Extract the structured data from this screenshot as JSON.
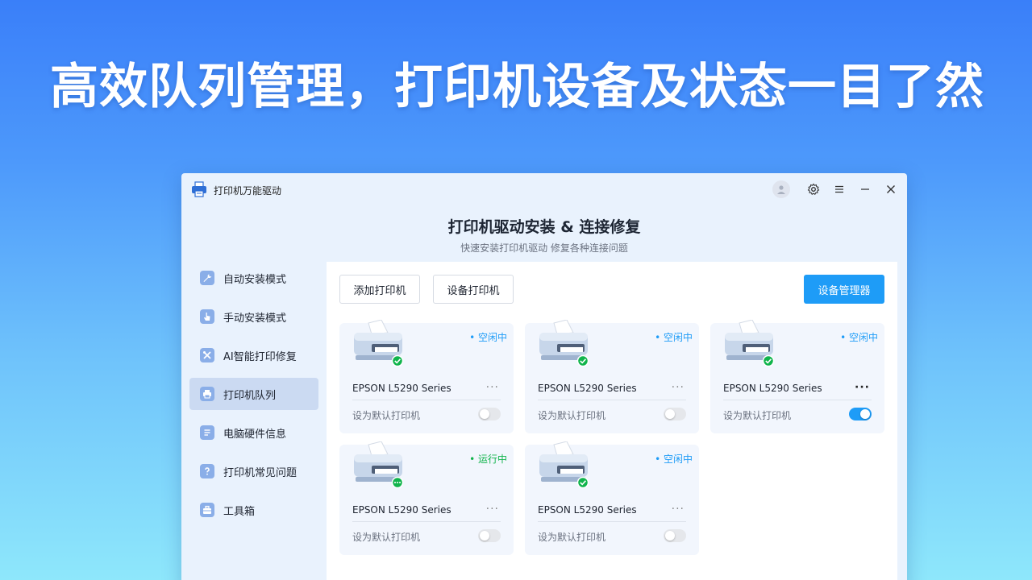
{
  "headline": "高效队列管理，打印机设备及状态一目了然",
  "window": {
    "app_title": "打印机万能驱动",
    "icons": [
      "printer-logo-icon",
      "avatar-icon",
      "gear-icon",
      "menu-icon",
      "minimize-icon",
      "close-icon"
    ]
  },
  "hero": {
    "title": "打印机驱动安装 & 连接修复",
    "subtitle": "快速安装打印机驱动   修复各种连接问题"
  },
  "sidebar": {
    "items": [
      {
        "label": "自动安装模式",
        "icon": "wrench-icon"
      },
      {
        "label": "手动安装模式",
        "icon": "hand-pointer-icon"
      },
      {
        "label": "AI智能打印修复",
        "icon": "tools-icon"
      },
      {
        "label": "打印机队列",
        "icon": "printer-icon",
        "active": true
      },
      {
        "label": "电脑硬件信息",
        "icon": "document-icon"
      },
      {
        "label": "打印机常见问题",
        "icon": "question-icon"
      },
      {
        "label": "工具箱",
        "icon": "toolbox-icon"
      }
    ]
  },
  "toolbar": {
    "add_label": "添加打印机",
    "share_label": "设备打印机",
    "device_manager_label": "设备管理器"
  },
  "printers": [
    {
      "name": "EPSON L5290 Series",
      "status": "• 空闲中",
      "state": "idle",
      "default_label": "设为默认打印机",
      "is_default": false,
      "more": "···"
    },
    {
      "name": "EPSON L5290 Series",
      "status": "• 空闲中",
      "state": "idle",
      "default_label": "设为默认打印机",
      "is_default": false,
      "more": "···"
    },
    {
      "name": "EPSON L5290 Series",
      "status": "• 空闲中",
      "state": "idle",
      "default_label": "设为默认打印机",
      "is_default": true,
      "more": "···"
    },
    {
      "name": "EPSON L5290 Series",
      "status": "• 运行中",
      "state": "running",
      "default_label": "设为默认打印机",
      "is_default": false,
      "more": "···"
    },
    {
      "name": "EPSON L5290 Series",
      "status": "• 空闲中",
      "state": "idle",
      "default_label": "设为默认打印机",
      "is_default": false,
      "more": "···"
    }
  ],
  "colors": {
    "accent": "#1e9cf7",
    "running": "#11b44c",
    "sidebar_active": "#cbdaf2"
  }
}
